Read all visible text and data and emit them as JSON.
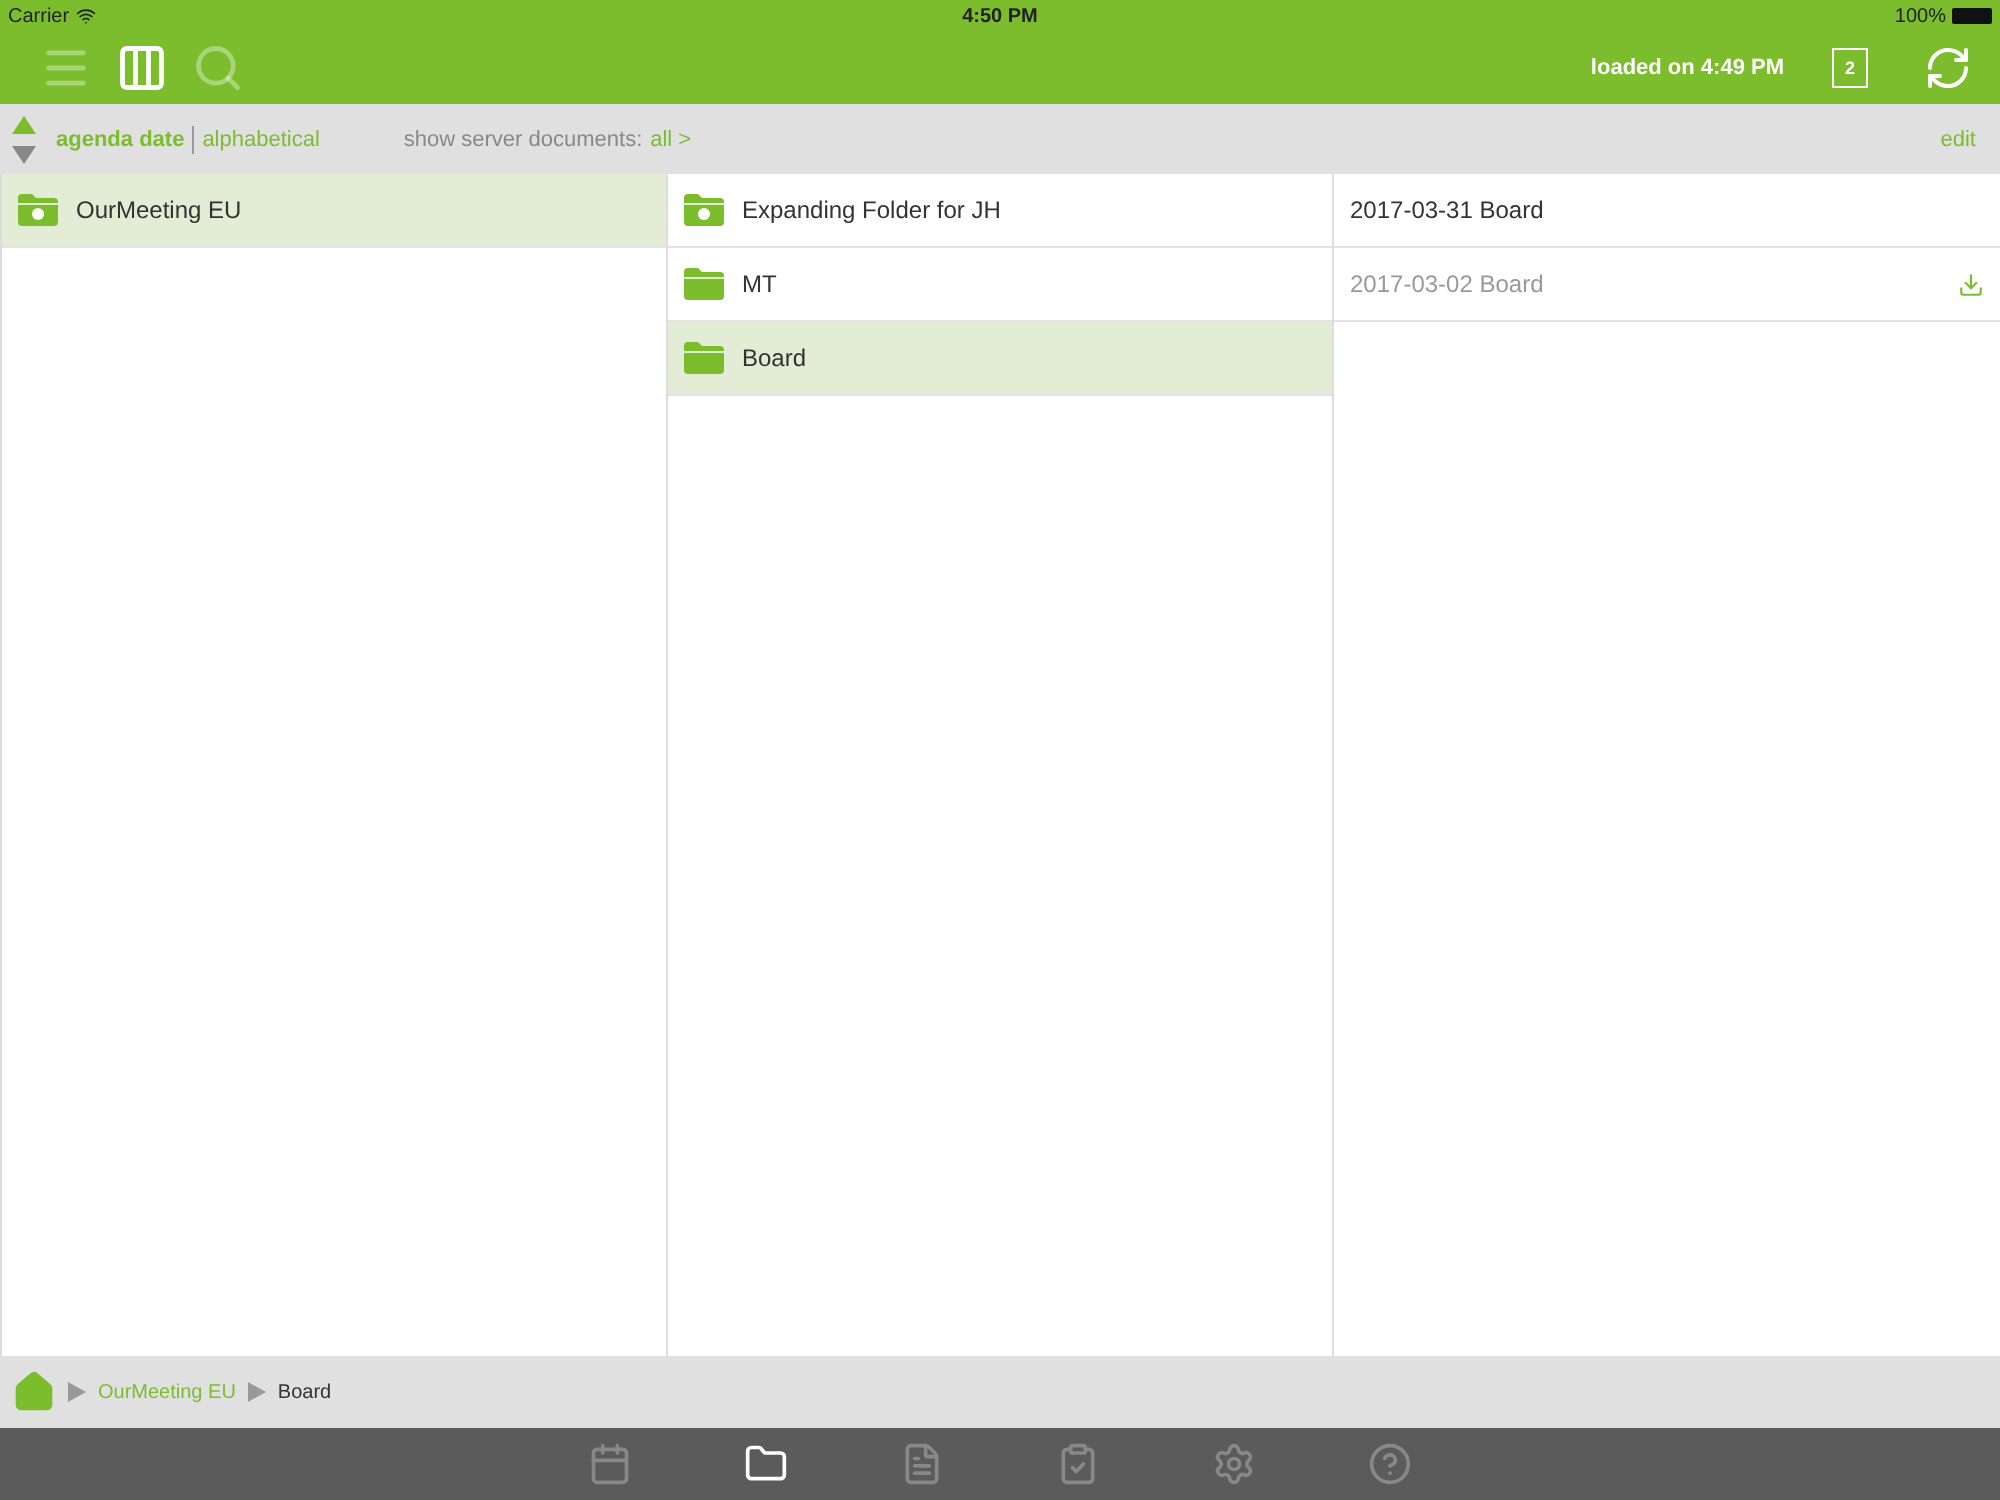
{
  "status_bar": {
    "carrier": "Carrier",
    "time": "4:50 PM",
    "battery": "100%"
  },
  "toolbar": {
    "view_buttons": [
      {
        "selected": false
      },
      {
        "selected": true
      },
      {
        "selected": false
      }
    ],
    "loaded": "loaded on 4:49 PM",
    "queue_count": "2"
  },
  "sort_bar": {
    "options": [
      {
        "label": "agenda date",
        "selected": true
      },
      {
        "label": "alphabetical",
        "selected": false
      }
    ],
    "server_label": "show server documents:",
    "server_value": "all >",
    "edit": "edit"
  },
  "columns": [
    {
      "items": [
        {
          "kind": "meeting",
          "label": "OurMeeting EU",
          "selected": true
        }
      ]
    },
    {
      "items": [
        {
          "kind": "meeting",
          "label": "Expanding Folder for JH",
          "selected": false
        },
        {
          "kind": "folder",
          "label": "MT",
          "selected": false
        },
        {
          "kind": "folder",
          "label": "Board",
          "selected": true
        }
      ]
    },
    {
      "items": [
        {
          "kind": "document",
          "label": "2017-03-31 Board",
          "selected": false,
          "downloaded": true
        },
        {
          "kind": "document",
          "label": "2017-03-02 Board",
          "selected": false,
          "downloaded": false
        }
      ]
    }
  ],
  "breadcrumb": [
    "OurMeeting EU",
    "Board"
  ],
  "tab_bar": [
    {
      "selected": false
    },
    {
      "selected": true
    },
    {
      "selected": false
    },
    {
      "selected": false
    },
    {
      "selected": false
    },
    {
      "selected": false
    }
  ]
}
